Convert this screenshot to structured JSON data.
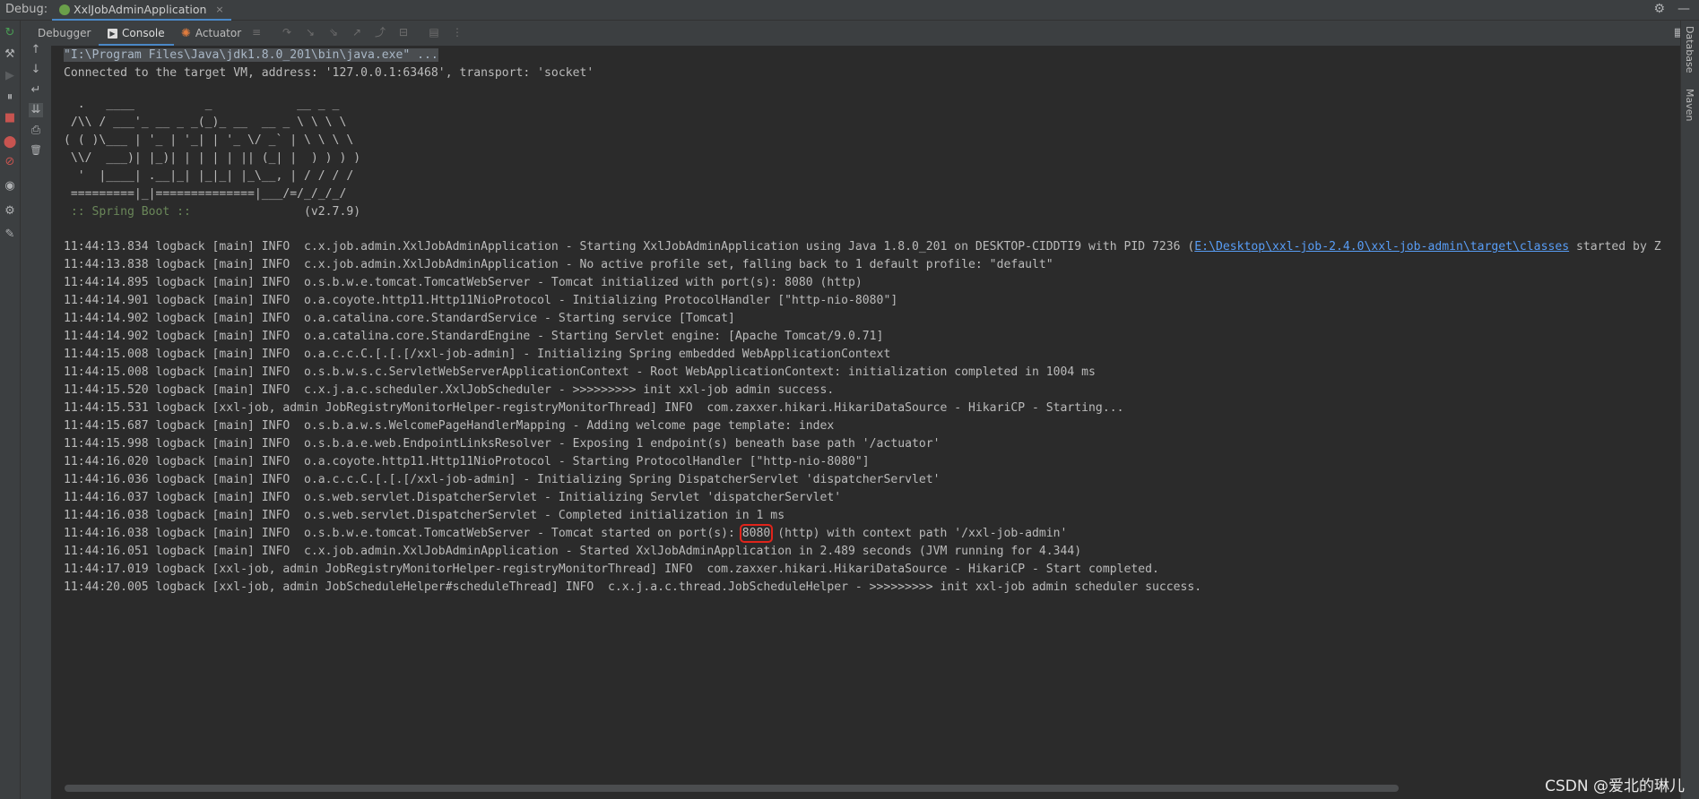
{
  "title_bar": {
    "debug_label": "Debug:",
    "run_config_tab": "XxlJobAdminApplication",
    "close_glyph": "×",
    "settings_glyph": "⚙",
    "minimize_glyph": "—"
  },
  "toolbar": {
    "tabs": [
      {
        "label": "Debugger"
      },
      {
        "label": "Console"
      },
      {
        "label": "Actuator"
      }
    ],
    "active_tab": "Console",
    "console_icon": "▶",
    "actuator_icon": "✺",
    "layout_glyph": "▦"
  },
  "right_panels": {
    "database": "Database",
    "maven": "Maven"
  },
  "icon_glyphs": {
    "rerun": "↻",
    "wrench": "⚒",
    "resume": "▶",
    "pause": "⏸",
    "stop": "■",
    "view_breakpoints": "⬤",
    "mute_breakpoints": "⊘",
    "camera": "◉",
    "settings": "⚙",
    "pin": "✎",
    "scroll_up": "↑",
    "scroll_down": "↓",
    "soft_wrap": "↵",
    "scroll_to_end": "⇊",
    "print": "⎙",
    "trash": "🗑",
    "tb_list": "≡",
    "tb_step_over": "↷",
    "tb_step_into": "↘",
    "tb_step_force": "⇘",
    "tb_step_out": "↗",
    "tb_run_cursor": "⤴",
    "tb_eval": "⊟",
    "tb_table": "▤",
    "tb_more": "⋮"
  },
  "console": {
    "command_line": "\"I:\\Program Files\\Java\\jdk1.8.0_201\\bin\\java.exe\" ...",
    "connected_line": "Connected to the target VM, address: '127.0.0.1:63468', transport: 'socket'",
    "banner": [
      "  .   ____          _            __ _ _",
      " /\\\\ / ___'_ __ _ _(_)_ __  __ _ \\ \\ \\ \\",
      "( ( )\\___ | '_ | '_| | '_ \\/ _` | \\ \\ \\ \\",
      " \\\\/  ___)| |_)| | | | | || (_| |  ) ) ) )",
      "  '  |____| .__|_| |_|_| |_\\__, | / / / /",
      " =========|_|==============|___/=/_/_/_/"
    ],
    "spring_label": " :: Spring Boot :: ",
    "spring_version": "               (v2.7.9)",
    "log_lines": [
      {
        "pre": "11:44:13.834 logback [main] INFO  c.x.job.admin.XxlJobAdminApplication - Starting XxlJobAdminApplication using Java 1.8.0_201 on DESKTOP-CIDDTI9 with PID 7236 (",
        "link": "E:\\Desktop\\xxl-job-2.4.0\\xxl-job-admin\\target\\classes",
        "post": " started by Z"
      },
      {
        "pre": "11:44:13.838 logback [main] INFO  c.x.job.admin.XxlJobAdminApplication - No active profile set, falling back to 1 default profile: \"default\"",
        "link": "",
        "post": ""
      },
      {
        "pre": "11:44:14.895 logback [main] INFO  o.s.b.w.e.tomcat.TomcatWebServer - Tomcat initialized with port(s): 8080 (http)",
        "link": "",
        "post": ""
      },
      {
        "pre": "11:44:14.901 logback [main] INFO  o.a.coyote.http11.Http11NioProtocol - Initializing ProtocolHandler [\"http-nio-8080\"]",
        "link": "",
        "post": ""
      },
      {
        "pre": "11:44:14.902 logback [main] INFO  o.a.catalina.core.StandardService - Starting service [Tomcat]",
        "link": "",
        "post": ""
      },
      {
        "pre": "11:44:14.902 logback [main] INFO  o.a.catalina.core.StandardEngine - Starting Servlet engine: [Apache Tomcat/9.0.71]",
        "link": "",
        "post": ""
      },
      {
        "pre": "11:44:15.008 logback [main] INFO  o.a.c.c.C.[.[.[/xxl-job-admin] - Initializing Spring embedded WebApplicationContext",
        "link": "",
        "post": ""
      },
      {
        "pre": "11:44:15.008 logback [main] INFO  o.s.b.w.s.c.ServletWebServerApplicationContext - Root WebApplicationContext: initialization completed in 1004 ms",
        "link": "",
        "post": ""
      },
      {
        "pre": "11:44:15.520 logback [main] INFO  c.x.j.a.c.scheduler.XxlJobScheduler - >>>>>>>>> init xxl-job admin success.",
        "link": "",
        "post": ""
      },
      {
        "pre": "11:44:15.531 logback [xxl-job, admin JobRegistryMonitorHelper-registryMonitorThread] INFO  com.zaxxer.hikari.HikariDataSource - HikariCP - Starting...",
        "link": "",
        "post": ""
      },
      {
        "pre": "11:44:15.687 logback [main] INFO  o.s.b.a.w.s.WelcomePageHandlerMapping - Adding welcome page template: index",
        "link": "",
        "post": ""
      },
      {
        "pre": "11:44:15.998 logback [main] INFO  o.s.b.a.e.web.EndpointLinksResolver - Exposing 1 endpoint(s) beneath base path '/actuator'",
        "link": "",
        "post": ""
      },
      {
        "pre": "11:44:16.020 logback [main] INFO  o.a.coyote.http11.Http11NioProtocol - Starting ProtocolHandler [\"http-nio-8080\"]",
        "link": "",
        "post": ""
      },
      {
        "pre": "11:44:16.036 logback [main] INFO  o.a.c.c.C.[.[.[/xxl-job-admin] - Initializing Spring DispatcherServlet 'dispatcherServlet'",
        "link": "",
        "post": ""
      },
      {
        "pre": "11:44:16.037 logback [main] INFO  o.s.web.servlet.DispatcherServlet - Initializing Servlet 'dispatcherServlet'",
        "link": "",
        "post": ""
      },
      {
        "pre": "11:44:16.038 logback [main] INFO  o.s.web.servlet.DispatcherServlet - Completed initialization in 1 ms",
        "link": "",
        "post": ""
      }
    ],
    "started_line": {
      "pre": "11:44:16.038 logback [main] INFO  o.s.b.w.e.tomcat.TomcatWebServer - Tomcat started on port(s): ",
      "port": "8080",
      "post": " (http) with context path '/xxl-job-admin'"
    },
    "tail_lines": [
      "11:44:16.051 logback [main] INFO  c.x.job.admin.XxlJobAdminApplication - Started XxlJobAdminApplication in 2.489 seconds (JVM running for 4.344)",
      "11:44:17.019 logback [xxl-job, admin JobRegistryMonitorHelper-registryMonitorThread] INFO  com.zaxxer.hikari.HikariDataSource - HikariCP - Start completed.",
      "11:44:20.005 logback [xxl-job, admin JobScheduleHelper#scheduleThread] INFO  c.x.j.a.c.thread.JobScheduleHelper - >>>>>>>>> init xxl-job admin scheduler success."
    ]
  },
  "watermark": "CSDN @爱北的琳儿",
  "colors": {
    "background": "#2b2b2b",
    "panel": "#3c3f41",
    "accent": "#4a88c7",
    "highlight_box": "#e0241b",
    "spring_green": "#6a8759",
    "link_blue": "#589df6"
  }
}
